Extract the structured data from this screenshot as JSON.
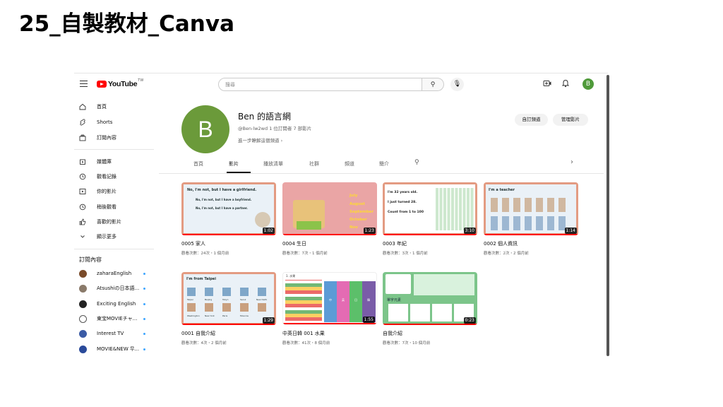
{
  "slide_title": "25_自製教材_Canva",
  "topbar": {
    "logo_text": "YouTube",
    "logo_region": "TW",
    "search_placeholder": "搜尋",
    "avatar_letter": "B"
  },
  "sidebar": {
    "main": [
      {
        "label": "首頁",
        "icon": "home-icon"
      },
      {
        "label": "Shorts",
        "icon": "shorts-icon"
      },
      {
        "label": "訂閱內容",
        "icon": "subscriptions-icon"
      }
    ],
    "library": [
      {
        "label": "媒體庫",
        "icon": "library-icon"
      },
      {
        "label": "觀看記錄",
        "icon": "history-icon"
      },
      {
        "label": "你的影片",
        "icon": "your-videos-icon"
      },
      {
        "label": "稍後觀看",
        "icon": "watch-later-icon"
      },
      {
        "label": "喜歡的影片",
        "icon": "liked-icon"
      },
      {
        "label": "顯示更多",
        "icon": "chevron-down-icon"
      }
    ],
    "subs_heading": "訂閱內容",
    "subscriptions": [
      {
        "label": "zaharaEnglish",
        "color": "#7a4b2a"
      },
      {
        "label": "Atsushiの日本語...",
        "color": "#8a7a6a"
      },
      {
        "label": "Exciting English",
        "color": "#222222"
      },
      {
        "label": "東宝MOVIEチャ...",
        "color": "#555555"
      },
      {
        "label": "Interest TV",
        "color": "#3b5ba5"
      },
      {
        "label": "MOVIE&NEW 무...",
        "color": "#2a4a9a"
      }
    ]
  },
  "channel": {
    "avatar_letter": "B",
    "name": "Ben 的語言網",
    "handle_meta": "@Ben-lw2wd  1 位訂閱者  7 部影片",
    "more_link": "進一步瞭解這個頻道  ›",
    "customize_button": "自訂頻道",
    "manage_button": "管理影片"
  },
  "tabs": [
    {
      "label": "首頁"
    },
    {
      "label": "影片"
    },
    {
      "label": "播放清單"
    },
    {
      "label": "社群"
    },
    {
      "label": "頻道"
    },
    {
      "label": "簡介"
    }
  ],
  "videos": [
    {
      "title": "0005 家人",
      "meta": "觀看次數：24次・1 個月前",
      "duration": "1:02",
      "thumb_lines": [
        "No, I'm not, but I have a girlfriend.",
        "No, I'm not, but I have a boyfriend.",
        "No, I'm not, but I have a partner."
      ]
    },
    {
      "title": "0004 生日",
      "meta": "觀看次數：7次・1 個月前",
      "duration": "1:23",
      "thumb_lines": [
        "July",
        "August",
        "September",
        "October",
        "Nov"
      ]
    },
    {
      "title": "0003 年紀",
      "meta": "觀看次數：3次・1 個月前",
      "duration": "3:10",
      "thumb_lines": [
        "I'm 32 years old.",
        "I just turned 28.",
        "Count from 1 to 100"
      ]
    },
    {
      "title": "0002 個人資訊",
      "meta": "觀看次數：2次・2 個月前",
      "duration": "1:14",
      "thumb_lines": [
        "I'm a teacher"
      ]
    },
    {
      "title": "0001 自我介紹",
      "meta": "觀看次數：4次・2 個月前",
      "duration": "1:29",
      "thumb_lines": [
        "I'm from Taipei",
        "Taipei",
        "Beijing",
        "Tokyo",
        "Seoul",
        "New Delhi",
        "Washington",
        "New York",
        "Paris",
        "Moscow"
      ]
    },
    {
      "title": "中英日韓 001 水果",
      "meta": "觀看次數：41次・8 個月前",
      "duration": "1:55",
      "thumb_lines": [
        "1. 水果",
        "中",
        "英",
        "日",
        "韓"
      ]
    },
    {
      "title": "自我介紹",
      "meta": "觀看次數：7次・10 個月前",
      "duration": "0:23",
      "thumb_lines": [
        "單字元素"
      ]
    }
  ],
  "colors": {
    "brand_red": "#ff0000",
    "avatar_green": "#6b9a3a",
    "thumb_border": "#e39b82"
  }
}
